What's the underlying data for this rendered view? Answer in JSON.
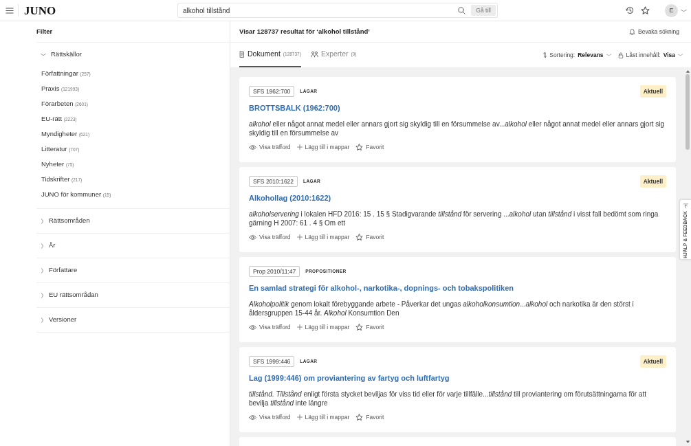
{
  "top_bar": {
    "logo": "JUNO",
    "search": {
      "value": "alkohol tillstånd",
      "button": "Gå till"
    },
    "avatar": "E"
  },
  "sidebar": {
    "title": "Filter",
    "sections": [
      {
        "label": "Rättskällor",
        "expanded": true,
        "items": [
          {
            "label": "Författningar",
            "count": "(257)"
          },
          {
            "label": "Praxis",
            "count": "(121993)"
          },
          {
            "label": "Förarbeten",
            "count": "(2601)"
          },
          {
            "label": "EU-rätt",
            "count": "(2223)"
          },
          {
            "label": "Myndigheter",
            "count": "(621)"
          },
          {
            "label": "Litteratur",
            "count": "(707)"
          },
          {
            "label": "Nyheter",
            "count": "(75)"
          },
          {
            "label": "Tidskrifter",
            "count": "(217)"
          },
          {
            "label": "JUNO för kommuner",
            "count": "(15)"
          }
        ]
      },
      {
        "label": "Rättsområden",
        "expanded": false
      },
      {
        "label": "År",
        "expanded": false
      },
      {
        "label": "Författare",
        "expanded": false
      },
      {
        "label": "EU rättsområdan",
        "expanded": false
      },
      {
        "label": "Versioner",
        "expanded": false
      }
    ]
  },
  "results_header": {
    "summary": "Visar 128737 resultat för ‘alkohol tillstånd’",
    "watch_button": "Bevaka sökning"
  },
  "tabs": [
    {
      "kind": "documents",
      "label": "Dokument",
      "count": "(128737)",
      "selected": true
    },
    {
      "kind": "experts",
      "label": "Experter",
      "count": "(0)",
      "selected": false
    }
  ],
  "sort": {
    "label": "Sortering:",
    "value": "Relevans"
  },
  "locked_content": {
    "label": "Låst innehåll:",
    "value": "Visa"
  },
  "results": [
    {
      "kind": "result",
      "reference": "SFS 1962:700",
      "category": "LAGAR",
      "status": "Aktuell",
      "title": "BROTTSBALK (1962:700)",
      "snippet": "*alkohol* eller något annat medel eller annars gjort sig skyldig till en försummelse av...*alkohol* eller något annat medel eller annars gjort sig skyldig till en försummelse av",
      "actions": [
        {
          "kind": "view",
          "label": "Visa träfford"
        },
        {
          "kind": "add",
          "label": "Lägg till i mappar"
        },
        {
          "kind": "favorite",
          "label": "Favorit"
        }
      ]
    },
    {
      "kind": "result",
      "reference": "SFS 2010:1622",
      "category": "LAGAR",
      "status": "Aktuell",
      "title": "Alkohollag (2010:1622)",
      "snippet": "*alkoholservering* i lokalen HFD 2016: 15 . 15 § Stadigvarande *tillstånd* för servering ...*alkohol* utan *tillstånd* i visst fall bedömt som ringa gärning H 2007: 61 . 4 § Om ett",
      "actions": [
        {
          "kind": "view",
          "label": "Visa träfford"
        },
        {
          "kind": "add",
          "label": "Lägg till i mappar"
        },
        {
          "kind": "favorite",
          "label": "Favorit"
        }
      ]
    },
    {
      "kind": "result",
      "reference": "Prop 2010/11:47",
      "category": "PROPOSITIONER",
      "title": "En samlad strategi för alkohol-, narkotika-, dopnings- och tobakspolitiken",
      "snippet": "*Alkoholpolitik* genom lokalt förebyggande arbete - Påverkar det ungas *alkoholkonsumtion*...*alkohol* och narkotika är den störst i åldersgruppen 15-44 år. *Alkohol* Konsumtion Den",
      "actions": [
        {
          "kind": "view",
          "label": "Visa träfford"
        },
        {
          "kind": "add",
          "label": "Lägg till i mappar"
        },
        {
          "kind": "favorite",
          "label": "Favorit"
        }
      ]
    },
    {
      "kind": "result",
      "reference": "SFS 1999:446",
      "category": "LAGAR",
      "status": "Aktuell",
      "title": "Lag (1999:446) om proviantering av fartyg och luftfartyg",
      "snippet": "*tillstånd.* *Tillstånd* enligt första stycket beviljas för viss tid eller för varje tillfälle...*tillstånd* till proviantering om förutsättningarna för att bevilja *tillstånd* inte längre",
      "actions": [
        {
          "kind": "view",
          "label": "Visa träfford"
        },
        {
          "kind": "add",
          "label": "Lägg till i mappar"
        },
        {
          "kind": "favorite",
          "label": "Favorit"
        }
      ]
    },
    {
      "kind": "cut-off"
    }
  ],
  "feedback_tab": "HJÄLP & FEEDBACK"
}
